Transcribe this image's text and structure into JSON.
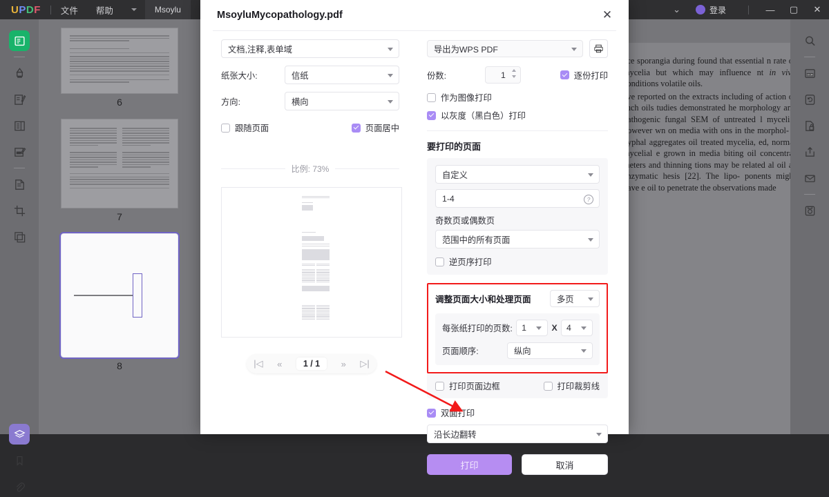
{
  "app": {
    "logo": "UPDF",
    "menu": [
      "文件",
      "帮助"
    ],
    "tab_label": "Msoylu",
    "account_label": "登录",
    "window_controls": {
      "minimize": "—",
      "maximize": "▢",
      "close": "✕"
    },
    "left_rail_icons": [
      "reader-icon",
      "highlight-icon",
      "annotate-icon",
      "form-icon",
      "edit-icon",
      "organize-pages-icon",
      "crop-icon",
      "compare-icon"
    ],
    "left_rail_bottom_icons": [
      "layers-icon",
      "bookmark-icon",
      "attachment-icon"
    ],
    "right_rail_icons": [
      "search-icon",
      "ocr-icon",
      "convert-icon",
      "protect-icon",
      "share-icon",
      "email-icon",
      "save-icon"
    ],
    "doc_toolbar_icons": [
      "chevron-down-icon",
      "present-icon"
    ]
  },
  "thumbnails": {
    "items": [
      {
        "page_number": "6",
        "selected": false
      },
      {
        "page_number": "7",
        "selected": false
      },
      {
        "page_number": "8",
        "selected": true
      }
    ]
  },
  "document_text": {
    "paragraph_1": "ace sporangia during found that essential n rate of mycelia but which may influence nt <i>in vivo</i> conditions volatile oils.",
    "paragraph_2": "ave reported on the extracts including of action of such oils tudies demonstrated he morphology and pathogenic fungal SEM of untreated l mycelia, however wn on media with ons in the morphol- d hyphal aggregates oil treated mycelia, ed, normal mycelial e grown in media biting oil concentra- meters and thinning tions may be related al oil as enzymatic hesis [22]. The lipo- ponents might have e oil to penetrate the observations made"
  },
  "dialog": {
    "title": "MsoyluMycopathology.pdf",
    "close_label": "✕",
    "left": {
      "content_select": {
        "value": "文档,注释,表单域"
      },
      "paper_size": {
        "label": "纸张大小:",
        "value": "信纸"
      },
      "orientation": {
        "label": "方向:",
        "value": "横向"
      },
      "follow_page": {
        "label": "跟随页面",
        "checked": false
      },
      "center_page": {
        "label": "页面居中",
        "checked": true
      },
      "ratio_label": "比例: 73%",
      "pager": {
        "first": "|◁",
        "prev": "«",
        "current": "1 / 1",
        "next": "»",
        "last": "▷|"
      }
    },
    "right": {
      "printer": {
        "value": "导出为WPS PDF"
      },
      "printer_icon": "printer-icon",
      "copies": {
        "label": "份数:",
        "value": "1"
      },
      "collate": {
        "label": "逐份打印",
        "checked": true
      },
      "print_as_image": {
        "label": "作为图像打印",
        "checked": false
      },
      "print_grayscale": {
        "label": "以灰度（黑白色）打印",
        "checked": true
      },
      "pages_section_title": "要打印的页面",
      "page_mode": {
        "value": "自定义"
      },
      "page_range": {
        "value": "1-4",
        "hint_icon": "question-icon"
      },
      "odd_even_label": "奇数页或偶数页",
      "odd_even": {
        "value": "范围中的所有页面"
      },
      "reverse_order": {
        "label": "逆页序打印",
        "checked": false
      },
      "resize_section": {
        "title": "调整页面大小和处理页面",
        "mode": {
          "value": "多页"
        },
        "pages_per_sheet": {
          "label": "每张纸打印的页数:",
          "cols": "1",
          "separator": "X",
          "rows": "4"
        },
        "page_order": {
          "label": "页面顺序:",
          "value": "纵向"
        }
      },
      "print_page_border": {
        "label": "打印页面边框",
        "checked": false
      },
      "print_crop_marks": {
        "label": "打印裁剪线",
        "checked": false
      },
      "duplex": {
        "label": "双面打印",
        "checked": true
      },
      "duplex_mode": {
        "value": "沿长边翻转"
      },
      "print_button": "打印",
      "cancel_button": "取消"
    }
  },
  "colors": {
    "accent_purple": "#a98cf5",
    "primary_button": "#b68df2",
    "highlight_red": "#f21a1a",
    "active_green": "#19b36a"
  }
}
